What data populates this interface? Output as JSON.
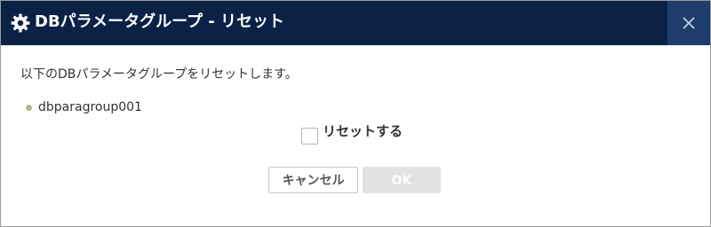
{
  "dialog": {
    "title": "DBパラメータグループ - リセット",
    "title_icon": "gear-icon",
    "close_icon": "close-icon",
    "message": "以下のDBパラメータグループをリセットします。",
    "items": [
      {
        "name": "dbparagroup001"
      }
    ],
    "confirm_checkbox": {
      "label": "リセットする",
      "checked": false
    },
    "buttons": {
      "cancel_label": "キャンセル",
      "ok_label": "OK",
      "ok_disabled": true
    }
  },
  "colors": {
    "titlebar_bg": "#0b2246",
    "close_bg": "#1e3d6d",
    "bullet": "#b7b38e",
    "ok_disabled_bg": "#e2e2e2"
  }
}
